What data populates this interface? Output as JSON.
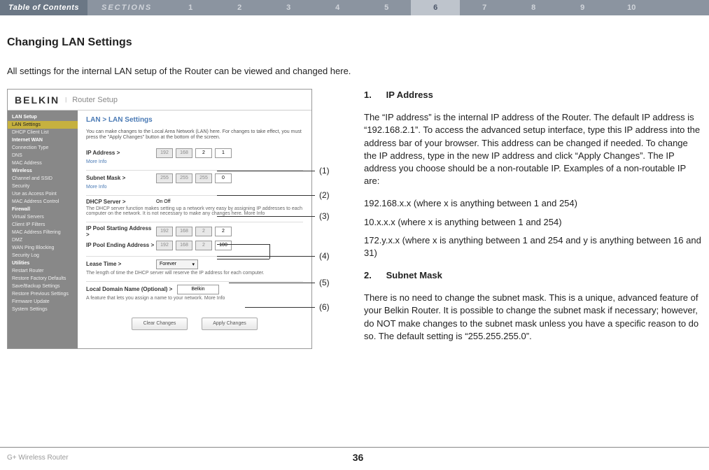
{
  "nav": {
    "toc_label": "Table of Contents",
    "sections_label": "SECTIONS",
    "numbers": [
      "1",
      "2",
      "3",
      "4",
      "5",
      "6",
      "7",
      "8",
      "9",
      "10"
    ],
    "active_index": 5
  },
  "heading": "Changing LAN Settings",
  "intro": "All settings for the internal LAN setup of the Router can be viewed and changed here.",
  "callouts": [
    "(1)",
    "(2)",
    "(3)",
    "(4)",
    "(5)",
    "(6)"
  ],
  "screenshot": {
    "logo": "BELKIN",
    "title": "Router Setup",
    "breadcrumb": "LAN > LAN Settings",
    "desc": "You can make changes to the Local Area Network (LAN) here. For changes to take effect, you must press the \"Apply Changes\" button at the bottom of the screen.",
    "sidebar": {
      "items": [
        {
          "label": "LAN Setup",
          "hl": false,
          "bold": true
        },
        {
          "label": "LAN Settings",
          "hl": true,
          "bold": false
        },
        {
          "label": "DHCP Client List",
          "hl": false,
          "bold": false
        },
        {
          "label": "Internet WAN",
          "hl": false,
          "bold": true
        },
        {
          "label": "Connection Type",
          "hl": false,
          "bold": false
        },
        {
          "label": "DNS",
          "hl": false,
          "bold": false
        },
        {
          "label": "MAC Address",
          "hl": false,
          "bold": false
        },
        {
          "label": "Wireless",
          "hl": false,
          "bold": true
        },
        {
          "label": "Channel and SSID",
          "hl": false,
          "bold": false
        },
        {
          "label": "Security",
          "hl": false,
          "bold": false
        },
        {
          "label": "Use as Access Point",
          "hl": false,
          "bold": false
        },
        {
          "label": "MAC Address Control",
          "hl": false,
          "bold": false
        },
        {
          "label": "Firewall",
          "hl": false,
          "bold": true
        },
        {
          "label": "Virtual Servers",
          "hl": false,
          "bold": false
        },
        {
          "label": "Client IP Filters",
          "hl": false,
          "bold": false
        },
        {
          "label": "MAC Address Filtering",
          "hl": false,
          "bold": false
        },
        {
          "label": "DMZ",
          "hl": false,
          "bold": false
        },
        {
          "label": "WAN Ping Blocking",
          "hl": false,
          "bold": false
        },
        {
          "label": "Security Log",
          "hl": false,
          "bold": false
        },
        {
          "label": "Utilities",
          "hl": false,
          "bold": true
        },
        {
          "label": "Restart Router",
          "hl": false,
          "bold": false
        },
        {
          "label": "Restore Factory Defaults",
          "hl": false,
          "bold": false
        },
        {
          "label": "Save/Backup Settings",
          "hl": false,
          "bold": false
        },
        {
          "label": "Restore Previous Settings",
          "hl": false,
          "bold": false
        },
        {
          "label": "Firmware Update",
          "hl": false,
          "bold": false
        },
        {
          "label": "System Settings",
          "hl": false,
          "bold": false
        }
      ]
    },
    "fields": {
      "ip_label": "IP Address >",
      "ip_values": [
        "192",
        "168",
        "2",
        "1"
      ],
      "subnet_label": "Subnet Mask >",
      "subnet_values": [
        "255",
        "255",
        "255",
        "0"
      ],
      "dhcp_label": "DHCP Server >",
      "dhcp_options": "On  Off",
      "dhcp_desc": "The DHCP server function makes setting up a network very easy by assigning IP addresses to each computer on the network. It is not necessary to make any changes here. More Info",
      "pool_start_label": "IP Pool Starting Address >",
      "pool_start_values": [
        "192",
        "168",
        "2",
        "2"
      ],
      "pool_end_label": "IP Pool Ending Address >",
      "pool_end_values": [
        "192",
        "168",
        "2",
        "100"
      ],
      "lease_label": "Lease Time >",
      "lease_value": "Forever",
      "lease_note": "The length of time the DHCP server will reserve the IP address for each computer.",
      "domain_label": "Local Domain Name  (Optional) >",
      "domain_value": "Belkin",
      "domain_note": "A feature that lets you assign a name to your network. More Info",
      "more_info": "More Info"
    },
    "btn_clear": "Clear Changes",
    "btn_apply": "Apply Changes"
  },
  "content": {
    "s1_head_num": "1.",
    "s1_head": "IP Address",
    "s1_p1": "The “IP address” is the internal IP address of the Router. The default IP address is “192.168.2.1”. To access the advanced setup interface, type this IP address into the address bar of your browser. This address can be changed if needed. To change the IP address, type in the new IP address and click “Apply Changes”. The IP address you choose should be a non-routable IP. Examples of a non-routable IP are:",
    "s1_ex1": "192.168.x.x (where x is anything between 1 and 254)",
    "s1_ex2": "10.x.x.x (where x is anything between 1 and 254)",
    "s1_ex3": "172.y.x.x (where x is anything between 1 and 254 and y is anything between 16 and 31)",
    "s2_head_num": "2.",
    "s2_head": "Subnet Mask",
    "s2_p1": "There is no need to change the subnet mask. This is a unique, advanced feature of your Belkin Router. It is possible to change the subnet mask if necessary; however, do NOT make changes to the subnet mask unless you have a specific reason to do so. The default setting is “255.255.255.0”."
  },
  "footer": {
    "product": "G+ Wireless Router",
    "page": "36"
  }
}
